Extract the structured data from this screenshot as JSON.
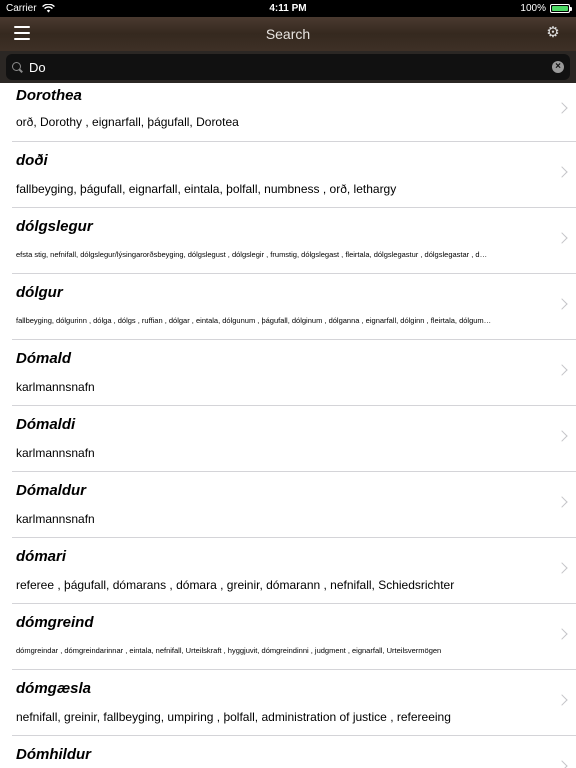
{
  "statusbar": {
    "carrier": "Carrier",
    "time": "4:11 PM",
    "battery": "100%",
    "battery_level": 1.0
  },
  "navbar": {
    "title": "Search"
  },
  "search": {
    "value": "Do",
    "placeholder": ""
  },
  "results": [
    {
      "title": "Dorothea",
      "sub": "orð, Dorothy , eignarfall, þágufall, Dorotea",
      "small": false
    },
    {
      "title": "doði",
      "sub": "fallbeyging, þágufall, eignarfall, eintala, þolfall, numbness , orð, lethargy",
      "small": false
    },
    {
      "title": "dólgslegur",
      "sub": "efsta stig, nefnifall, dólgslegur/lýsingarorðsbeyging, dólgslegust , dólgslegir , frumstig, dólgslegast , fleirtala, dólgslegastur , dólgslegastar , d…",
      "small": true
    },
    {
      "title": "dólgur",
      "sub": "fallbeyging, dólgurinn , dólga , dólgs , ruffian , dólgar , eintala, dólgunum , þágufall, dólginum , dólganna , eignarfall, dólginn , fleirtala, dólgum…",
      "small": true
    },
    {
      "title": "Dómald",
      "sub": "karlmannsnafn",
      "small": false
    },
    {
      "title": "Dómaldi",
      "sub": "karlmannsnafn",
      "small": false
    },
    {
      "title": "Dómaldur",
      "sub": "karlmannsnafn",
      "small": false
    },
    {
      "title": "dómari",
      "sub": "referee , þágufall, dómarans , dómara , greinir, dómarann , nefnifall, Schiedsrichter",
      "small": false
    },
    {
      "title": "dómgreind",
      "sub": "dómgreindar , dómgreindarinnar , eintala, nefnifall, Urteilskraft , hyggjuvit, dómgreindinni , judgment , eignarfall, Urteilsvermögen",
      "small": true
    },
    {
      "title": "dómgæsla",
      "sub": "nefnifall, greinir, fallbeyging, umpiring , þolfall, administration of justice , refereeing",
      "small": false
    },
    {
      "title": "Dómhildur",
      "sub": "",
      "small": false
    }
  ]
}
